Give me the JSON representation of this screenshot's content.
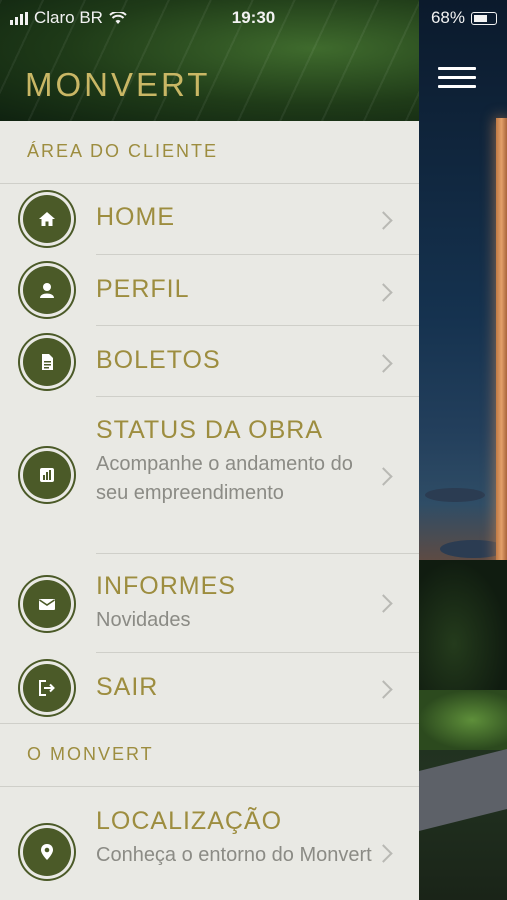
{
  "status_bar": {
    "carrier": "Claro BR",
    "time": "19:30",
    "battery": "68%"
  },
  "app": {
    "logo": "MONVERT"
  },
  "sections": {
    "client_area": "ÁREA DO CLIENTE",
    "monvert": "O MONVERT"
  },
  "menu": {
    "home": {
      "label": "HOME",
      "icon": "home-icon"
    },
    "perfil": {
      "label": "PERFIL",
      "icon": "user-icon"
    },
    "boletos": {
      "label": "BOLETOS",
      "icon": "document-icon"
    },
    "status": {
      "label": "STATUS DA OBRA",
      "sub": "Acompanhe o andamento do seu empreendimento",
      "icon": "bar-chart-icon"
    },
    "informes": {
      "label": "INFORMES",
      "sub": "Novidades",
      "icon": "mail-icon"
    },
    "sair": {
      "label": "SAIR",
      "icon": "logout-icon"
    },
    "localizacao": {
      "label": "LOCALIZAÇÃO",
      "sub": "Conheça o entorno do Monvert",
      "icon": "location-pin-icon"
    }
  },
  "colors": {
    "accent": "#9d8d3f",
    "icon_bg": "#4b5a28",
    "drawer_bg": "#e9e9e4",
    "subtext": "#8b8b85"
  }
}
